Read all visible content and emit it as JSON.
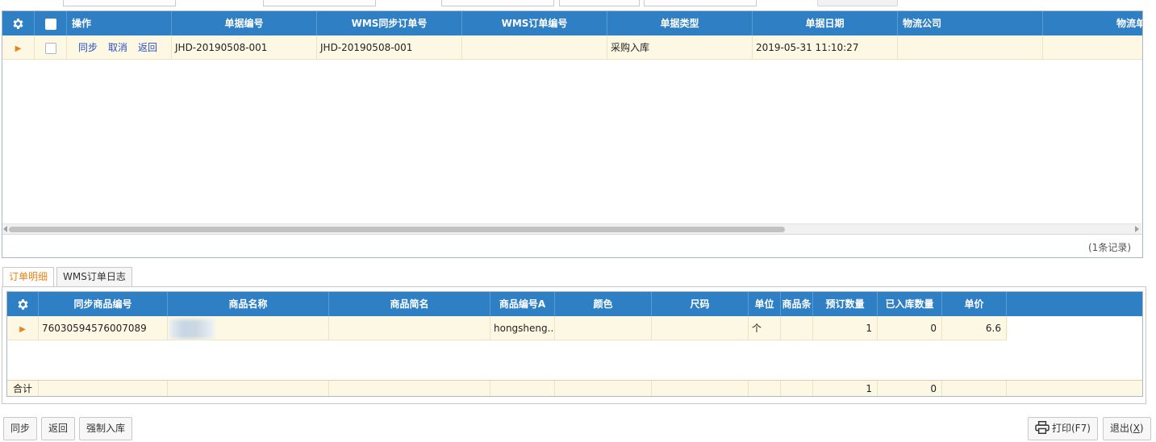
{
  "master_grid": {
    "columns": [
      "操作",
      "单据编号",
      "WMS同步订单号",
      "WMS订单编号",
      "单据类型",
      "单据日期",
      "物流公司",
      "物流单号"
    ],
    "row": {
      "actions": [
        "同步",
        "取消",
        "返回"
      ],
      "doc_no": "JHD-20190508-001",
      "wms_sync_no": "JHD-20190508-001",
      "wms_order_no": "",
      "doc_type": "采购入库",
      "doc_date": "2019-05-31 11:10:27",
      "logistics_company": "",
      "tracking_no": ""
    },
    "record_count": "(1条记录)"
  },
  "tabs": [
    "订单明细",
    "WMS订单日志"
  ],
  "detail_grid": {
    "columns": [
      "同步商品编号",
      "商品名称",
      "商品简名",
      "商品编号A",
      "颜色",
      "尺码",
      "单位",
      "商品条",
      "预订数量",
      "已入库数量",
      "单价"
    ],
    "row": {
      "sync_sku": "76030594576007089",
      "product_name": "",
      "short_name": "",
      "sku_a": "hongsheng...",
      "color": "",
      "size": "",
      "unit": "个",
      "barcode": "",
      "ordered_qty": "1",
      "received_qty": "0",
      "price": "6.6"
    },
    "summary": {
      "label": "合计",
      "ordered_qty": "1",
      "received_qty": "0"
    }
  },
  "footer": {
    "sync": "同步",
    "back": "返回",
    "force_in": "强制入库",
    "print": "打印(F7)",
    "exit_prefix": "退出(",
    "exit_key": "X",
    "exit_suffix": ")"
  },
  "colors": {
    "header_blue": "#2f7fc4",
    "row_highlight": "#fdf8e3",
    "link_blue": "#2a4fc4",
    "accent_orange": "#e8841a"
  },
  "icons": [
    "gear-icon",
    "row-pointer-icon",
    "printer-icon",
    "scroll-left-icon",
    "scroll-right-icon"
  ]
}
